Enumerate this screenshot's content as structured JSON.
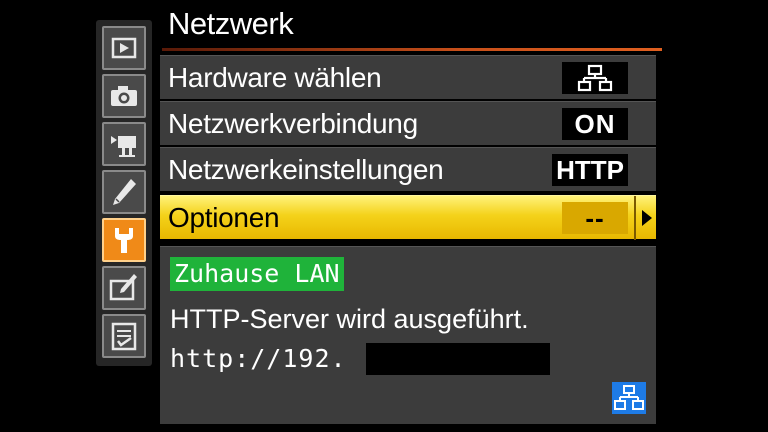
{
  "screen": {
    "title": "Netzwerk"
  },
  "tabs": [
    {
      "name": "playback-menu-tab",
      "icon": "play-icon",
      "active": false
    },
    {
      "name": "shooting-menu-tab",
      "icon": "camera-icon",
      "active": false
    },
    {
      "name": "movie-menu-tab",
      "icon": "movie-camera-icon",
      "active": false
    },
    {
      "name": "custom-settings-tab",
      "icon": "pencil-icon",
      "active": false
    },
    {
      "name": "setup-menu-tab",
      "icon": "wrench-icon",
      "active": true
    },
    {
      "name": "retouch-menu-tab",
      "icon": "retouch-brush-icon",
      "active": false
    },
    {
      "name": "my-menu-tab",
      "icon": "list-check-icon",
      "active": false
    }
  ],
  "menu": {
    "items": [
      {
        "label": "Hardware wählen",
        "value": "",
        "value_icon": "network-icon",
        "selected": false
      },
      {
        "label": "Netzwerkverbindung",
        "value": "ON",
        "selected": false
      },
      {
        "label": "Netzwerkeinstellungen",
        "value": "HTTP",
        "selected": false
      },
      {
        "label": "Optionen",
        "value": "--",
        "selected": true,
        "has_arrow": true
      }
    ]
  },
  "info": {
    "profile_name": "Zuhause LAN",
    "status": "HTTP-Server wird ausgeführt.",
    "url_prefix": "http://192.",
    "status_icon": "network-icon"
  },
  "colors": {
    "accent_orange": "#f08a18",
    "selected_yellow": "#f4d21a",
    "profile_green": "#1fb33a",
    "network_blue": "#1e7be6"
  }
}
